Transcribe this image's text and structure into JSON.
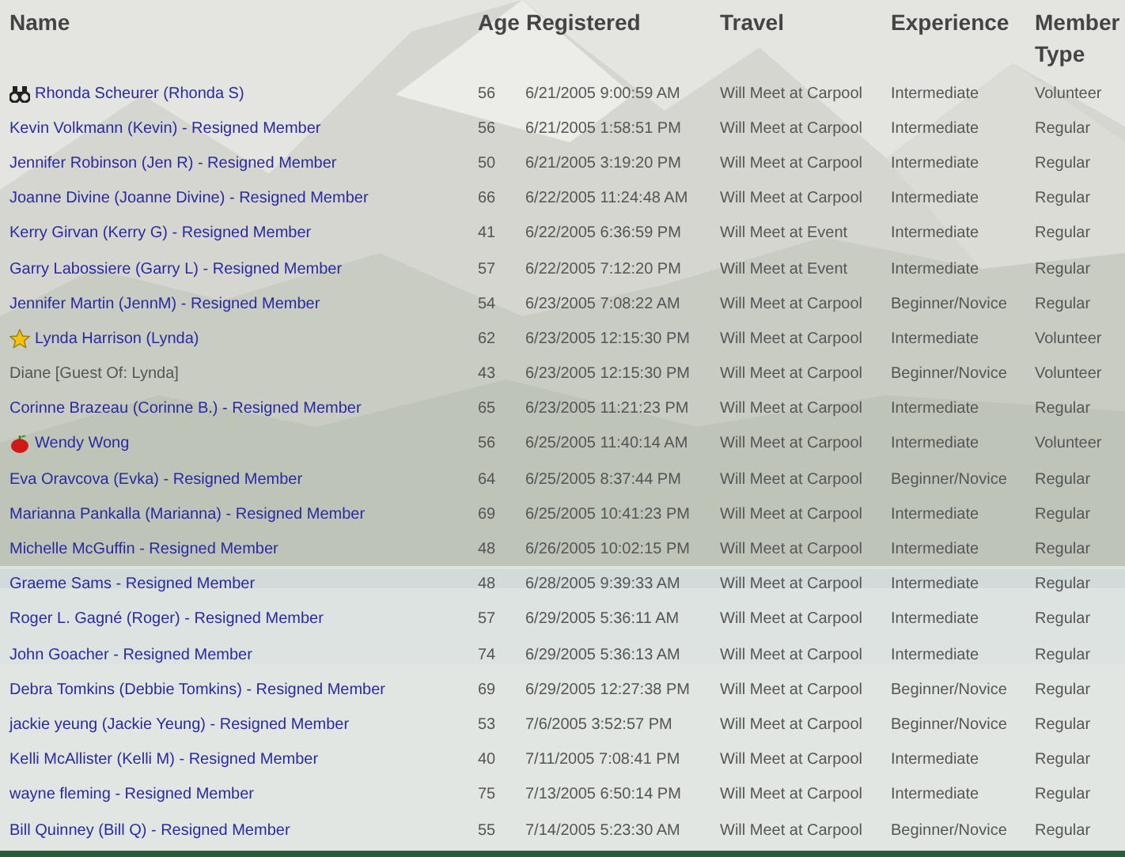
{
  "table": {
    "columns": [
      "Name",
      "Age",
      "Registered",
      "Travel",
      "Experience",
      "Member Type"
    ],
    "rows": [
      {
        "name": "Rhonda Scheurer (Rhonda S)",
        "kind": "binoculars",
        "linked": true,
        "age": "56",
        "registered": "6/21/2005 9:00:59 AM",
        "travel": "Will Meet at Carpool",
        "experience": "Intermediate",
        "type": "Volunteer"
      },
      {
        "name": "Kevin Volkmann (Kevin) - Resigned Member",
        "linked": true,
        "age": "56",
        "registered": "6/21/2005 1:58:51 PM",
        "travel": "Will Meet at Carpool",
        "experience": "Intermediate",
        "type": "Regular"
      },
      {
        "name": "Jennifer Robinson (Jen R) - Resigned Member",
        "linked": true,
        "age": "50",
        "registered": "6/21/2005 3:19:20 PM",
        "travel": "Will Meet at Carpool",
        "experience": "Intermediate",
        "type": "Regular"
      },
      {
        "name": "Joanne Divine (Joanne Divine) - Resigned Member",
        "linked": true,
        "age": "66",
        "registered": "6/22/2005 11:24:48 AM",
        "travel": "Will Meet at Carpool",
        "experience": "Intermediate",
        "type": "Regular"
      },
      {
        "name": "Kerry Girvan (Kerry G) - Resigned Member",
        "linked": true,
        "age": "41",
        "registered": "6/22/2005 6:36:59 PM",
        "travel": "Will Meet at Event",
        "experience": "Intermediate",
        "type": "Regular"
      },
      {
        "name": "Garry Labossiere (Garry L) - Resigned Member",
        "linked": true,
        "age": "57",
        "registered": "6/22/2005 7:12:20 PM",
        "travel": "Will Meet at Event",
        "experience": "Intermediate",
        "type": "Regular"
      },
      {
        "name": "Jennifer Martin (JennM) - Resigned Member",
        "linked": true,
        "age": "54",
        "registered": "6/23/2005 7:08:22 AM",
        "travel": "Will Meet at Carpool",
        "experience": "Beginner/Novice",
        "type": "Regular"
      },
      {
        "name": "Lynda Harrison (Lynda)",
        "kind": "star",
        "linked": true,
        "age": "62",
        "registered": "6/23/2005 12:15:30 PM",
        "travel": "Will Meet at Carpool",
        "experience": "Intermediate",
        "type": "Volunteer"
      },
      {
        "name": "Diane [Guest Of: Lynda]",
        "linked": false,
        "age": "43",
        "registered": "6/23/2005 12:15:30 PM",
        "travel": "Will Meet at Carpool",
        "experience": "Beginner/Novice",
        "type": "Volunteer"
      },
      {
        "name": "Corinne Brazeau (Corinne B.) - Resigned Member",
        "linked": true,
        "age": "65",
        "registered": "6/23/2005 11:21:23 PM",
        "travel": "Will Meet at Carpool",
        "experience": "Intermediate",
        "type": "Regular"
      },
      {
        "name": "Wendy Wong",
        "kind": "apple",
        "linked": true,
        "age": "56",
        "registered": "6/25/2005 11:40:14 AM",
        "travel": "Will Meet at Carpool",
        "experience": "Intermediate",
        "type": "Volunteer"
      },
      {
        "name": "Eva Oravcova (Evka) - Resigned Member",
        "linked": true,
        "age": "64",
        "registered": "6/25/2005 8:37:44 PM",
        "travel": "Will Meet at Carpool",
        "experience": "Beginner/Novice",
        "type": "Regular"
      },
      {
        "name": "Marianna Pankalla (Marianna) - Resigned Member",
        "linked": true,
        "age": "69",
        "registered": "6/25/2005 10:41:23 PM",
        "travel": "Will Meet at Carpool",
        "experience": "Intermediate",
        "type": "Regular"
      },
      {
        "name": "Michelle McGuffin - Resigned Member",
        "linked": true,
        "age": "48",
        "registered": "6/26/2005 10:02:15 PM",
        "travel": "Will Meet at Carpool",
        "experience": "Intermediate",
        "type": "Regular"
      },
      {
        "name": "Graeme Sams - Resigned Member",
        "linked": true,
        "age": "48",
        "registered": "6/28/2005 9:39:33 AM",
        "travel": "Will Meet at Carpool",
        "experience": "Intermediate",
        "type": "Regular"
      },
      {
        "name": "Roger L. Gagné (Roger) - Resigned Member",
        "linked": true,
        "age": "57",
        "registered": "6/29/2005 5:36:11 AM",
        "travel": "Will Meet at Carpool",
        "experience": "Intermediate",
        "type": "Regular"
      },
      {
        "name": "John Goacher - Resigned Member",
        "linked": true,
        "age": "74",
        "registered": "6/29/2005 5:36:13 AM",
        "travel": "Will Meet at Carpool",
        "experience": "Intermediate",
        "type": "Regular"
      },
      {
        "name": "Debra Tomkins (Debbie Tomkins) - Resigned Member",
        "linked": true,
        "age": "69",
        "registered": "6/29/2005 12:27:38 PM",
        "travel": "Will Meet at Carpool",
        "experience": "Beginner/Novice",
        "type": "Regular"
      },
      {
        "name": "jackie yeung (Jackie Yeung) - Resigned Member",
        "linked": true,
        "age": "53",
        "registered": "7/6/2005 3:52:57 PM",
        "travel": "Will Meet at Carpool",
        "experience": "Beginner/Novice",
        "type": "Regular"
      },
      {
        "name": "Kelli McAllister (Kelli M) - Resigned Member",
        "linked": true,
        "age": "40",
        "registered": "7/11/2005 7:08:41 PM",
        "travel": "Will Meet at Carpool",
        "experience": "Intermediate",
        "type": "Regular"
      },
      {
        "name": "wayne fleming - Resigned Member",
        "linked": true,
        "age": "75",
        "registered": "7/13/2005 6:50:14 PM",
        "travel": "Will Meet at Carpool",
        "experience": "Intermediate",
        "type": "Regular"
      },
      {
        "name": "Bill Quinney (Bill Q) - Resigned Member",
        "linked": true,
        "age": "55",
        "registered": "7/14/2005 5:23:30 AM",
        "travel": "Will Meet at Carpool",
        "experience": "Beginner/Novice",
        "type": "Regular"
      }
    ]
  }
}
